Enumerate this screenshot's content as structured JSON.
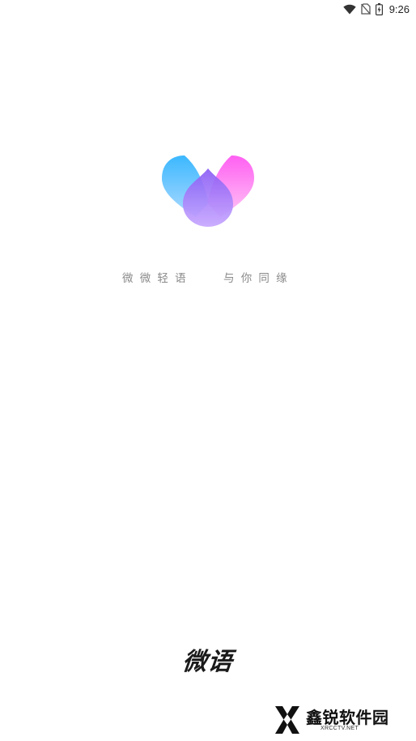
{
  "status_bar": {
    "time": "9:26",
    "icons": [
      "wifi-icon",
      "no-sim-icon",
      "battery-charging-icon"
    ]
  },
  "splash": {
    "logo": "heart-drops-logo",
    "slogan_left": "微微轻语",
    "slogan_right": "与你同缘",
    "app_name": "微语"
  },
  "watermark": {
    "text": "鑫锐软件园",
    "sub": "XRCCTV.NET"
  },
  "colors": {
    "logo_blue": "#3ab6ff",
    "logo_pink": "#ff5ef0",
    "logo_purple": "#8a63f4",
    "slogan_text": "#8a8a8a",
    "app_name_text": "#1a1a1a"
  }
}
